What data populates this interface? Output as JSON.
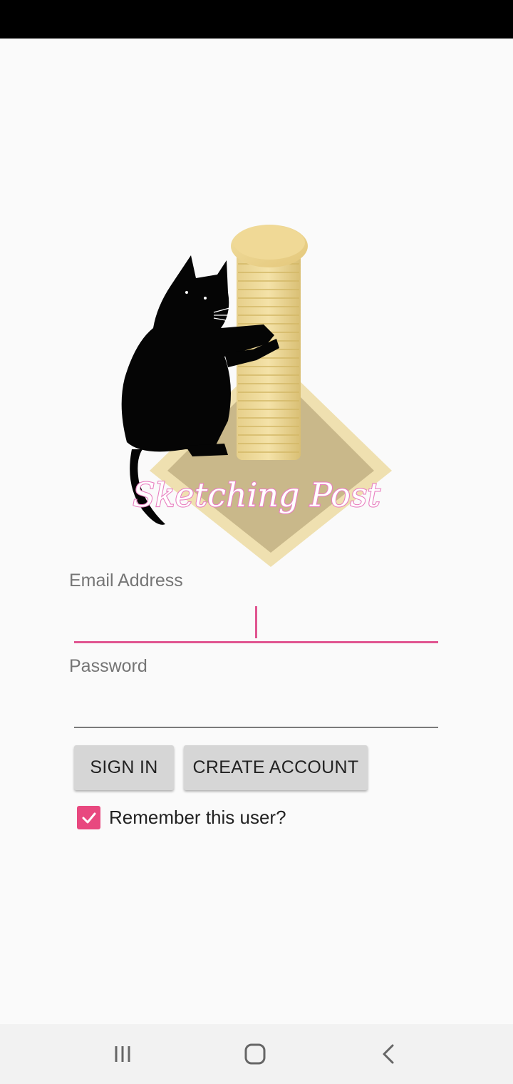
{
  "logo": {
    "text": "Sketching Post"
  },
  "form": {
    "email": {
      "label": "Email Address",
      "value": ""
    },
    "password": {
      "label": "Password",
      "value": ""
    },
    "sign_in_label": "SIGN IN",
    "create_account_label": "CREATE ACCOUNT",
    "remember": {
      "label": "Remember this user?",
      "checked": true
    }
  },
  "nav": {
    "recents_icon": "recents-icon",
    "home_icon": "home-icon",
    "back_icon": "back-icon"
  },
  "colors": {
    "accent": "#e8487f",
    "button_bg": "#d6d6d6",
    "background": "#fafafa"
  }
}
